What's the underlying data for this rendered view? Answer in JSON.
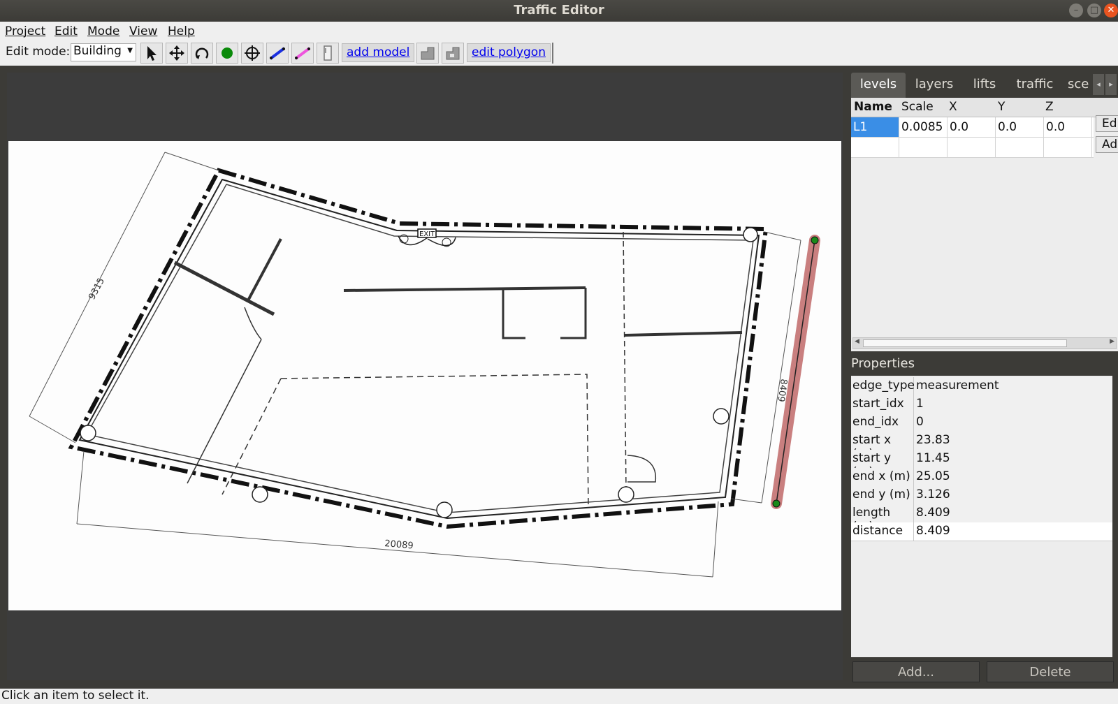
{
  "window": {
    "title": "Traffic Editor"
  },
  "menu": {
    "items": [
      "Project",
      "Edit",
      "Mode",
      "View",
      "Help"
    ]
  },
  "toolbar": {
    "edit_mode_label": "Edit mode:",
    "edit_mode_value": "Building",
    "add_model_label": "add model",
    "edit_polygon_label": "edit polygon",
    "tools": [
      "select-arrow-icon",
      "move-icon",
      "rotate-icon",
      "add-vertex-icon",
      "add-fiducial-icon",
      "add-wall-icon",
      "add-measurement-icon",
      "add-door-icon",
      "add-floor-icon",
      "add-hole-icon"
    ]
  },
  "tabs": [
    {
      "label": "levels",
      "active": true
    },
    {
      "label": "layers",
      "active": false
    },
    {
      "label": "lifts",
      "active": false
    },
    {
      "label": "traffic",
      "active": false
    },
    {
      "label": "sce",
      "active": false
    }
  ],
  "levels_table": {
    "headers": [
      "Name",
      "Scale",
      "X",
      "Y",
      "Z"
    ],
    "rows": [
      {
        "name": "L1",
        "scale": "0.0085",
        "x": "0.0",
        "y": "0.0",
        "z": "0.0"
      }
    ],
    "edit_button": "Ed",
    "add_button": "Ad"
  },
  "drawing": {
    "dimension_left": "9315",
    "dimension_bottom": "20089",
    "dimension_right": "8409",
    "exit_sign": "EXIT",
    "measurement_color": "#c97f7f",
    "vertex_color": "#1a8a1a"
  },
  "properties": {
    "title": "Properties",
    "rows": [
      {
        "key": "edge_type",
        "value": "measurement"
      },
      {
        "key": "start_idx",
        "value": "1"
      },
      {
        "key": "end_idx",
        "value": "0"
      },
      {
        "key": "start x (m)",
        "value": "23.83"
      },
      {
        "key": "start y (m)",
        "value": "11.45"
      },
      {
        "key": "end x (m)",
        "value": "25.05"
      },
      {
        "key": "end y (m)",
        "value": "3.126"
      },
      {
        "key": "length (m)",
        "value": "8.409"
      },
      {
        "key": "distance",
        "value": "8.409"
      }
    ],
    "add_button": "Add...",
    "delete_button": "Delete"
  },
  "status": {
    "text": "Click an item to select it."
  }
}
